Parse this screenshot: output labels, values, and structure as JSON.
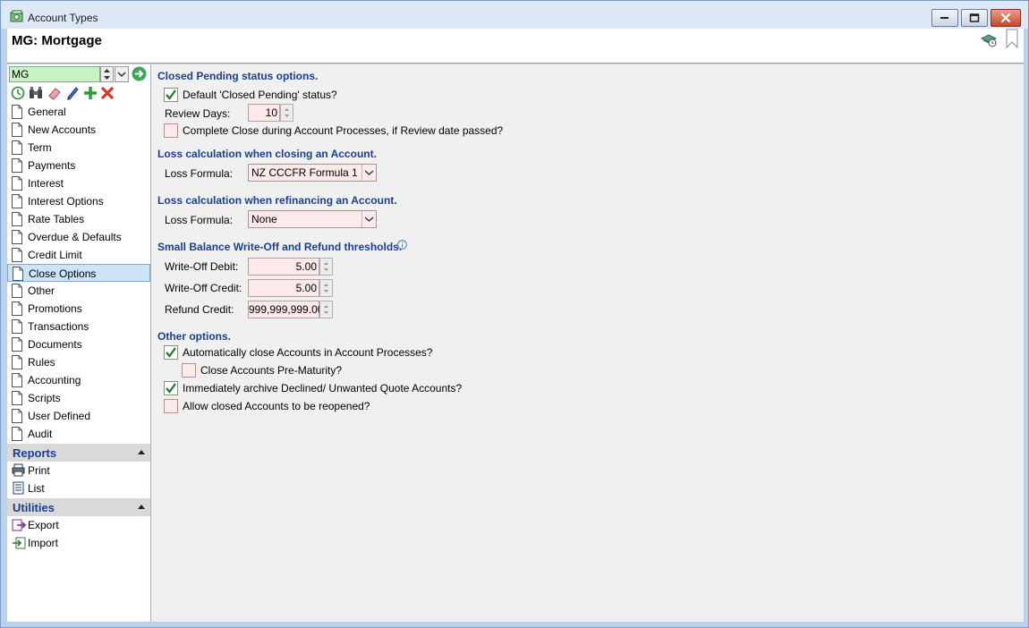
{
  "window": {
    "title": "Account Types"
  },
  "header": {
    "title": "MG: Mortgage"
  },
  "sidebar": {
    "selector_value": "MG",
    "nav_items": [
      {
        "label": "General"
      },
      {
        "label": "New Accounts"
      },
      {
        "label": "Term"
      },
      {
        "label": "Payments"
      },
      {
        "label": "Interest"
      },
      {
        "label": "Interest Options"
      },
      {
        "label": "Rate Tables"
      },
      {
        "label": "Overdue & Defaults"
      },
      {
        "label": "Credit Limit"
      },
      {
        "label": "Close Options",
        "selected": true
      },
      {
        "label": "Other"
      },
      {
        "label": "Promotions"
      },
      {
        "label": "Transactions"
      },
      {
        "label": "Documents"
      },
      {
        "label": "Rules"
      },
      {
        "label": "Accounting"
      },
      {
        "label": "Scripts"
      },
      {
        "label": "User Defined"
      },
      {
        "label": "Audit"
      }
    ],
    "reports": {
      "title": "Reports",
      "items": [
        {
          "label": "Print"
        },
        {
          "label": "List"
        }
      ]
    },
    "utilities": {
      "title": "Utilities",
      "items": [
        {
          "label": "Export"
        },
        {
          "label": "Import"
        }
      ]
    }
  },
  "main": {
    "closed_pending": {
      "title": "Closed Pending status options.",
      "default_status_label": "Default 'Closed Pending' status?",
      "default_status_checked": true,
      "review_days_label": "Review Days:",
      "review_days_value": "10",
      "complete_close_label": "Complete Close during Account Processes, if Review date passed?",
      "complete_close_checked": false
    },
    "loss_closing": {
      "title": "Loss calculation when closing an Account.",
      "formula_label": "Loss Formula:",
      "formula_value": "NZ CCCFR Formula 1"
    },
    "loss_refinancing": {
      "title": "Loss calculation when refinancing an Account.",
      "formula_label": "Loss Formula:",
      "formula_value": "None"
    },
    "thresholds": {
      "title": "Small Balance Write-Off and Refund thresholds.",
      "write_off_debit_label": "Write-Off Debit:",
      "write_off_debit_value": "5.00",
      "write_off_credit_label": "Write-Off Credit:",
      "write_off_credit_value": "5.00",
      "refund_credit_label": "Refund Credit:",
      "refund_credit_value": "999,999,999.00"
    },
    "other": {
      "title": "Other options.",
      "auto_close_label": "Automatically close Accounts in Account Processes?",
      "auto_close_checked": true,
      "pre_maturity_label": "Close Accounts Pre-Maturity?",
      "pre_maturity_checked": false,
      "archive_label": "Immediately archive Declined/ Unwanted Quote Accounts?",
      "archive_checked": true,
      "reopen_label": "Allow closed Accounts to be reopened?",
      "reopen_checked": false
    }
  }
}
